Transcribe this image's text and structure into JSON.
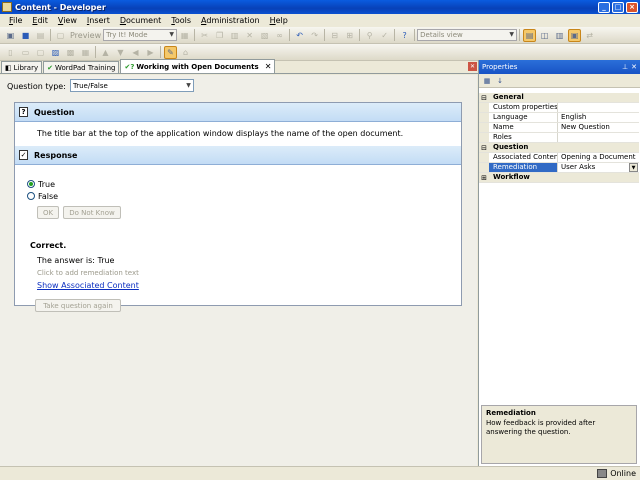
{
  "window": {
    "title": "Content - Developer"
  },
  "menu": [
    "File",
    "Edit",
    "View",
    "Insert",
    "Document",
    "Tools",
    "Administration",
    "Help"
  ],
  "toolbar": {
    "preview_label": "Preview",
    "mode_select": "Try It! Mode",
    "view_select": "Details view"
  },
  "tabs": [
    {
      "label": "Library",
      "icon": "library-icon"
    },
    {
      "label": "WordPad Training",
      "icon": "check-doc-icon"
    },
    {
      "label": "Working with Open Documents",
      "icon": "question-doc-icon"
    }
  ],
  "editor": {
    "question_type_label": "Question type:",
    "question_type_value": "True/False",
    "question_header": "Question",
    "question_text": "The title bar at the top of the application window displays the name of the open document.",
    "response_header": "Response",
    "options": [
      {
        "label": "True",
        "selected": true
      },
      {
        "label": "False",
        "selected": false
      }
    ],
    "ok_button": "OK",
    "dont_know_button": "Do Not Know"
  },
  "feedback": {
    "result": "Correct.",
    "answer": "The answer is: True",
    "remediation_hint": "Click to add remediation text",
    "assoc_link": "Show Associated Content",
    "retake_button": "Take question again"
  },
  "properties": {
    "title": "Properties",
    "categories": [
      {
        "name": "General",
        "expanded": true,
        "rows": [
          {
            "name": "Custom properties",
            "value": ""
          },
          {
            "name": "Language",
            "value": "English"
          },
          {
            "name": "Name",
            "value": "New Question"
          },
          {
            "name": "Roles",
            "value": ""
          }
        ]
      },
      {
        "name": "Question",
        "expanded": true,
        "rows": [
          {
            "name": "Associated Content",
            "value": "Opening a Document"
          },
          {
            "name": "Remediation",
            "value": "User Asks",
            "selected": true
          }
        ]
      },
      {
        "name": "Workflow",
        "expanded": false,
        "rows": []
      }
    ],
    "description": {
      "title": "Remediation",
      "text": "How feedback is provided after answering the question."
    }
  },
  "status": {
    "text": "Online"
  },
  "colors": {
    "titlebar": "#0a5ce0",
    "section_header": "#c3dcf5",
    "link": "#0a2ec0",
    "selection": "#316ac5"
  }
}
